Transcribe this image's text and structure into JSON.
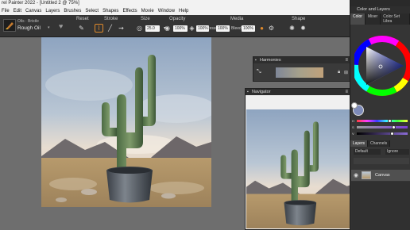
{
  "window": {
    "title": "rel Painter 2022 - [Untitled 2 @ 75%]"
  },
  "menu": [
    "File",
    "Edit",
    "Canvas",
    "Layers",
    "Brushes",
    "Select",
    "Shapes",
    "Effects",
    "Movie",
    "Window",
    "Help"
  ],
  "brush": {
    "category": "Oils · Bristle",
    "variant": "Rough Oil"
  },
  "propbar": {
    "reset": "Reset",
    "stroke": "Stroke",
    "size": "Size",
    "size_value": "25.0",
    "opacity": "Opacity",
    "opacity_value": "100%",
    "grain_value": "100%",
    "media": "Media",
    "resat_label": "Resat",
    "resat_value": "100%",
    "bleed_label": "Bleed",
    "bleed_value": "100%",
    "shape": "Shape"
  },
  "panels": {
    "harmonies": "Harmonies",
    "navigator": "Navigator",
    "color_and_layers": "Color and Layers"
  },
  "dock": {
    "color_tabs": [
      "Color",
      "Mixer",
      "Color Set Libra"
    ],
    "layer_tabs": [
      "Layers",
      "Channels"
    ],
    "blend_mode": "Default",
    "composite": "Ignore",
    "layer_name": "Canvas",
    "sliders": [
      {
        "label": "H",
        "value": 0.65
      },
      {
        "label": "S",
        "value": 0.72
      },
      {
        "label": "V",
        "value": 0.7
      }
    ]
  },
  "colors": {
    "current": "#7d8ab8",
    "accent": "#e08a2b"
  }
}
